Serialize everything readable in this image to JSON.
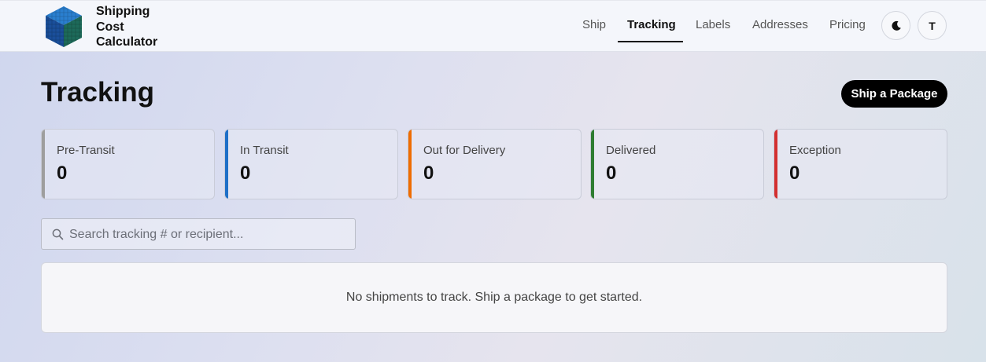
{
  "app": {
    "title": "Shipping Cost Calculator",
    "logo_icon": "cube-logo-icon"
  },
  "nav": {
    "items": [
      {
        "label": "Ship",
        "active": false
      },
      {
        "label": "Tracking",
        "active": true
      },
      {
        "label": "Labels",
        "active": false
      },
      {
        "label": "Addresses",
        "active": false
      },
      {
        "label": "Pricing",
        "active": false
      }
    ],
    "theme_toggle_icon": "moon-icon",
    "avatar_initial": "T"
  },
  "page": {
    "title": "Tracking",
    "primary_action": "Ship a Package"
  },
  "stats": [
    {
      "label": "Pre-Transit",
      "value": "0",
      "color": "#9e9e9e"
    },
    {
      "label": "In Transit",
      "value": "0",
      "color": "#1e6fc7"
    },
    {
      "label": "Out for Delivery",
      "value": "0",
      "color": "#ef6c00"
    },
    {
      "label": "Delivered",
      "value": "0",
      "color": "#2e7d32"
    },
    {
      "label": "Exception",
      "value": "0",
      "color": "#d32f2f"
    }
  ],
  "search": {
    "placeholder": "Search tracking # or recipient...",
    "value": ""
  },
  "empty_state": {
    "message": "No shipments to track. Ship a package to get started."
  }
}
